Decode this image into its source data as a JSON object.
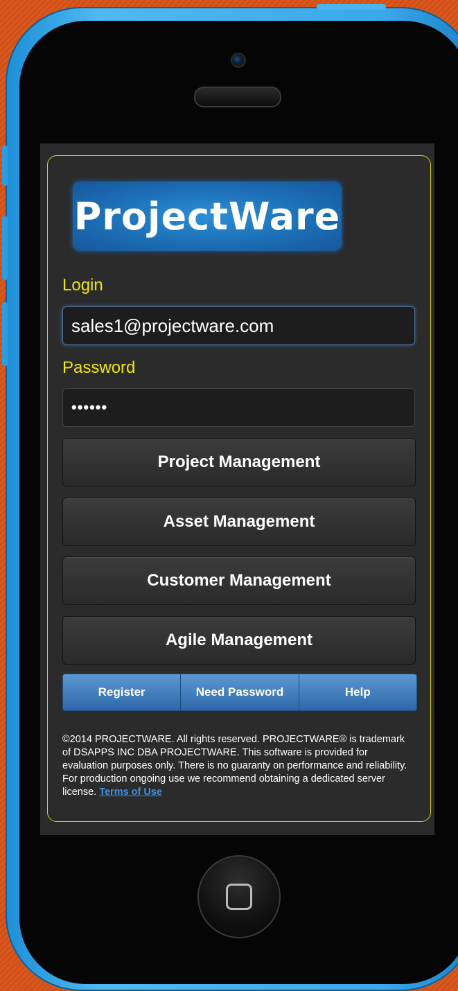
{
  "app": {
    "logo_text": "ProjectWare"
  },
  "login": {
    "login_label": "Login",
    "login_value": "sales1@projectware.com",
    "password_label": "Password",
    "password_value": "••••••"
  },
  "modules": [
    {
      "label": "Project Management"
    },
    {
      "label": "Asset Management"
    },
    {
      "label": "Customer Management"
    },
    {
      "label": "Agile Management"
    }
  ],
  "nav": {
    "register": "Register",
    "need_password": "Need Password",
    "help": "Help"
  },
  "footer": {
    "text": "©2014 PROJECTWARE. All rights reserved. PROJECTWARE® is trademark of DSAPPS INC DBA PROJECTWARE. This software is provided for evaluation purposes only. There is no guaranty on performance and reliability. For production ongoing use we recommend obtaining a dedicated server license.",
    "terms_link": "Terms of Use"
  },
  "colors": {
    "accent": "#f0e614",
    "nav_blue": "#2c68a8",
    "phone_frame": "#3aa9ea"
  },
  "icons": {
    "home_button": "home-square-icon",
    "camera": "camera-icon"
  }
}
